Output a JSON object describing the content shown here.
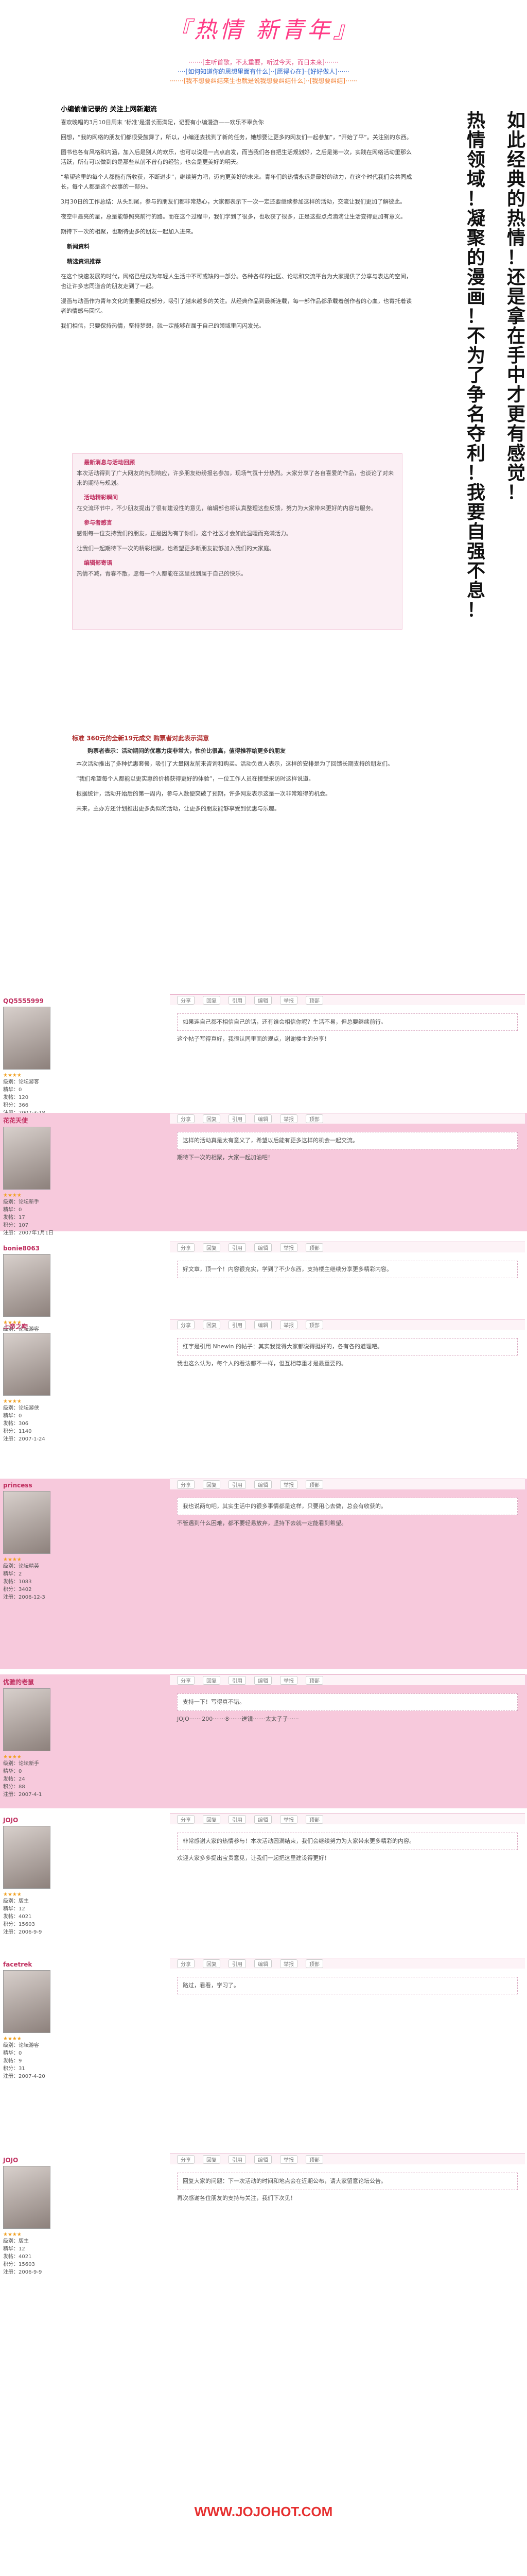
{
  "header": {
    "title": "『热情 新青年』",
    "line1": "·······[主听首歌，不太重要，听过今天，而日未来]·······",
    "line2": "····[如何知道你的思想里面有什么]··[愿得心在]··[好好做人]······",
    "line3": "·······[我不想要纠结来生也就是说我想要纠结什么]··[我想要纠结]······"
  },
  "side_text": {
    "col_a": [
      "热",
      "情",
      "领",
      "域",
      "！",
      "凝",
      "聚",
      "的",
      "漫",
      "画",
      "！",
      "不",
      "为",
      "了",
      "争",
      "名",
      "夺",
      "利",
      "！",
      "我",
      "要",
      "自",
      "强",
      "不",
      "息",
      "！"
    ],
    "col_b": [
      "如",
      "此",
      "经",
      "典",
      "的",
      "热",
      "情",
      "！",
      "还",
      "是",
      "拿",
      "在",
      "手",
      "中",
      "才",
      "更",
      "有",
      "感",
      "觉",
      "！"
    ]
  },
  "article": {
    "title": "小编偷偷记录的 关注上网新潮流",
    "paras": [
      "喜欢晚唱的3月10日周末 ‘标准’是漫长而满足，记要有小编漫游——欢乐不辜负你",
      "回想，“我的网络的朋友们都很受鼓舞了，所以，小编还去找到了新的任务，她想要让更多的网友们一起参加”，“开始了平”。关注别的东西。",
      "图书也各有风格和内涵，加入后是别人的欢乐，也可以说是一点点启发，而当我们各自把生活规划好，之后是第一次，实践在网络活动里那么活跃，所有可以做到的是那些从前不曾有的经验，也会是更美好的明天。",
      "“希望这里的每个人都能有所收获，不断进步”，继续努力吧，迈向更美好的未来。青年们的热情永远是最好的动力，在这个时代我们会共同成长，每个人都是这个故事的一部分。",
      "3月30日的工作总结：从头到尾，参与的朋友们都非常热心，大家都表示下一次一定还要继续参加这样的活动，交流让我们更加了解彼此。",
      "夜空中最亮的星，总是能够照亮前行的路。而在这个过程中，我们学到了很多，也收获了很多，正是这些点点滴滴让生活变得更加有意义。",
      "期待下一次的相聚，也期待更多的朋友一起加入进来。"
    ],
    "section1": "新闻资料",
    "section2": "精选资讯推荐",
    "paras2": [
      "在这个快速发展的时代，网络已经成为年轻人生活中不可或缺的一部分。各种各样的社区、论坛和交流平台为大家提供了分享与表达的空间，也让许多志同道合的朋友走到了一起。",
      "漫画与动画作为青年文化的重要组成部分，吸引了越来越多的关注。从经典作品到最新连载，每一部作品都承载着创作者的心血，也寄托着读者的情感与回忆。",
      "我们相信，只要保持热情，坚持梦想，就一定能够在属于自己的领域里闪闪发光。"
    ]
  },
  "pinkbox": {
    "head1": "最新消息与活动回顾",
    "head2": "活动精彩瞬间",
    "head3": "参与者感言",
    "head4": "编辑部寄语",
    "paras": [
      "本次活动得到了广大网友的热烈响应，许多朋友纷纷报名参加，现场气氛十分热烈。大家分享了各自喜爱的作品，也谈论了对未来的期待与规划。",
      "在交流环节中，不少朋友提出了很有建设性的意见，编辑部也将认真整理这些反馈，努力为大家带来更好的内容与服务。",
      "感谢每一位支持我们的朋友，正是因为有了你们，这个社区才会如此温暖而充满活力。",
      "让我们一起期待下一次的精彩相聚，也希望更多新朋友能够加入我们的大家庭。",
      "热情不减，青春不散，愿每一个人都能在这里找到属于自己的快乐。"
    ]
  },
  "article2": {
    "title": "标准 360元的全新19元成交 购票者对此表示满意",
    "subtitle": "购票者表示：活动期间的优惠力度非常大，性价比很高，值得推荐给更多的朋友",
    "paras": [
      "本次活动推出了多种优惠套餐，吸引了大量网友前来咨询和购买。活动负责人表示，这样的安排是为了回馈长期支持的朋友们。",
      "“我们希望每个人都能以更实惠的价格获得更好的体验”，一位工作人员在接受采访时这样说道。",
      "根据统计，活动开始后的第一周内，参与人数便突破了预期，许多网友表示这是一次非常难得的机会。",
      "未来，主办方还计划推出更多类似的活动，让更多的朋友能够享受到优惠与乐趣。"
    ]
  },
  "post_bar": {
    "share": "分享",
    "reply": "回复",
    "quote": "引用",
    "edit": "编辑",
    "report": "举报",
    "top": "顶部"
  },
  "posts": [
    {
      "user": "QQ5555999",
      "info": [
        "级别：论坛游客",
        "精华：0",
        "发帖：120",
        "积分：366",
        "注册：2007-3-18"
      ],
      "text": "如果连自己都不相信自己的话，还有谁会相信你呢？生活不易，但总要继续前行。",
      "text2": "这个帖子写得真好，我很认同里面的观点，谢谢楼主的分享！"
    },
    {
      "user": "花花天使",
      "info": [
        "级别：论坛新手",
        "精华：0",
        "发帖：17",
        "积分：107",
        "注册：2007年1月1日"
      ],
      "text": "这样的活动真是太有意义了，希望以后能有更多这样的机会一起交流。",
      "text2": "期待下一次的相聚，大家一起加油吧！"
    },
    {
      "user": "bonie8063",
      "info": [
        "级别：论坛游客",
        "精华：0",
        "发帖：58",
        "积分：241",
        "注册：2007-2-6"
      ],
      "text": "好文章，顶一个！内容很充实，学到了不少东西，支持楼主继续分享更多精彩内容。",
      "text2": ""
    },
    {
      "user": "上帝之吻",
      "info": [
        "级别：论坛游侠",
        "精华：0",
        "发帖：306",
        "积分：1140",
        "注册：2007-1-24"
      ],
      "text": "红字是引用 Nhewin 的帖子：其实我觉得大家都说得挺好的，各有各的道理吧。",
      "text2": "我也这么认为，每个人的看法都不一样，但互相尊重才是最重要的。"
    },
    {
      "user": "princess",
      "info": [
        "级别：论坛精英",
        "精华：2",
        "发帖：1083",
        "积分：3402",
        "注册：2006-12-3"
      ],
      "text": "我也说两句吧，其实生活中的很多事情都是这样，只要用心去做，总会有收获的。",
      "text2": "不管遇到什么困难，都不要轻易放弃，坚持下去就一定能看到希望。"
    },
    {
      "user": "优雅的老鼠",
      "info": [
        "级别：论坛新手",
        "精华：0",
        "发帖：24",
        "积分：88",
        "注册：2007-4-1"
      ],
      "text": "支持一下！写得真不错。",
      "text2": "JOJO·······200·······8·······送镜·······太太子子······"
    },
    {
      "user": "JOJO",
      "info": [
        "级别：版主",
        "精华：12",
        "发帖：4021",
        "积分：15603",
        "注册：2006-9-9"
      ],
      "text": "非常感谢大家的热情参与！本次活动圆满结束，我们会继续努力为大家带来更多精彩的内容。",
      "text2": "欢迎大家多多提出宝贵意见，让我们一起把这里建设得更好！"
    },
    {
      "user": "facetrek",
      "info": [
        "级别：论坛游客",
        "精华：0",
        "发帖：9",
        "积分：31",
        "注册：2007-4-20"
      ],
      "text": "路过，看看，学习了。",
      "text2": ""
    },
    {
      "user": "JOJO",
      "info": [
        "级别：版主",
        "精华：12",
        "发帖：4021",
        "积分：15603",
        "注册：2006-9-9"
      ],
      "text": "回复大家的问题：下一次活动的时间和地点会在近期公布，请大家留意论坛公告。",
      "text2": "再次感谢各位朋友的支持与关注，我们下次见！"
    }
  ],
  "footer": {
    "logo": "WWW.JOJOHOT.COM"
  }
}
